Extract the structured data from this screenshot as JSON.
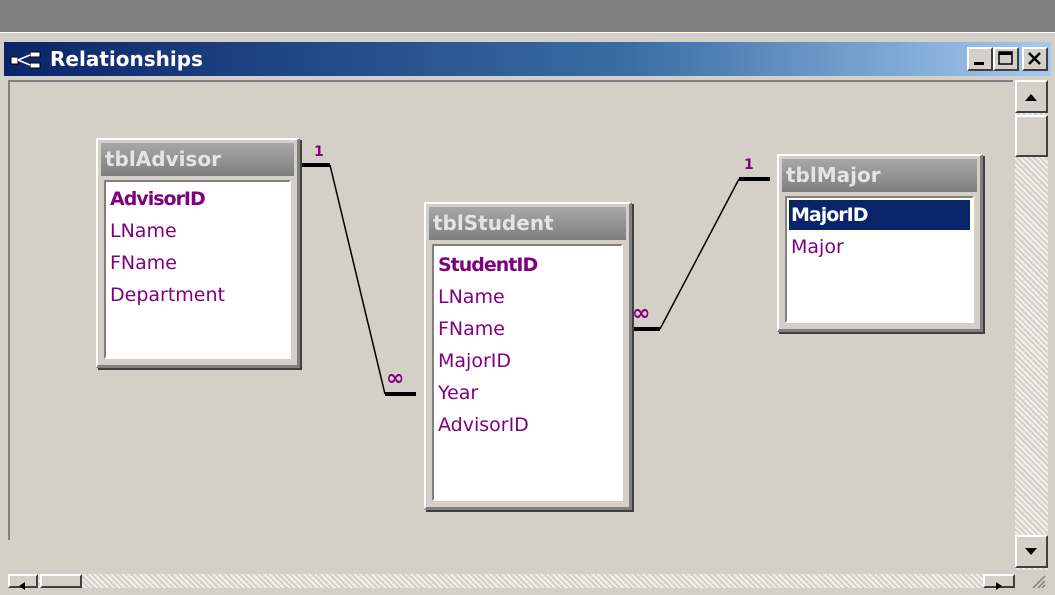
{
  "window": {
    "title": "Relationships",
    "controls": {
      "minimize": "_",
      "maximize": "□",
      "close": "✕"
    }
  },
  "tables": [
    {
      "id": "advisor",
      "name": "tblAdvisor",
      "fields": [
        {
          "label": "AdvisorID",
          "key": true
        },
        {
          "label": "LName"
        },
        {
          "label": "FName"
        },
        {
          "label": "Department"
        }
      ]
    },
    {
      "id": "student",
      "name": "tblStudent",
      "fields": [
        {
          "label": "StudentID",
          "key": true
        },
        {
          "label": "LName"
        },
        {
          "label": "FName"
        },
        {
          "label": "MajorID"
        },
        {
          "label": "Year"
        },
        {
          "label": "AdvisorID"
        }
      ]
    },
    {
      "id": "major",
      "name": "tblMajor",
      "fields": [
        {
          "label": "MajorID",
          "key": true,
          "selected": true
        },
        {
          "label": "Major"
        }
      ]
    }
  ],
  "relationships": [
    {
      "from": "tblAdvisor.AdvisorID",
      "to": "tblStudent.AdvisorID",
      "one_label": "1",
      "many_label": "∞"
    },
    {
      "from": "tblMajor.MajorID",
      "to": "tblStudent.MajorID",
      "one_label": "1",
      "many_label": "∞"
    }
  ],
  "colors": {
    "field_text": "#800080",
    "selection": "#0a246a",
    "title_gradient_start": "#0a246a"
  }
}
